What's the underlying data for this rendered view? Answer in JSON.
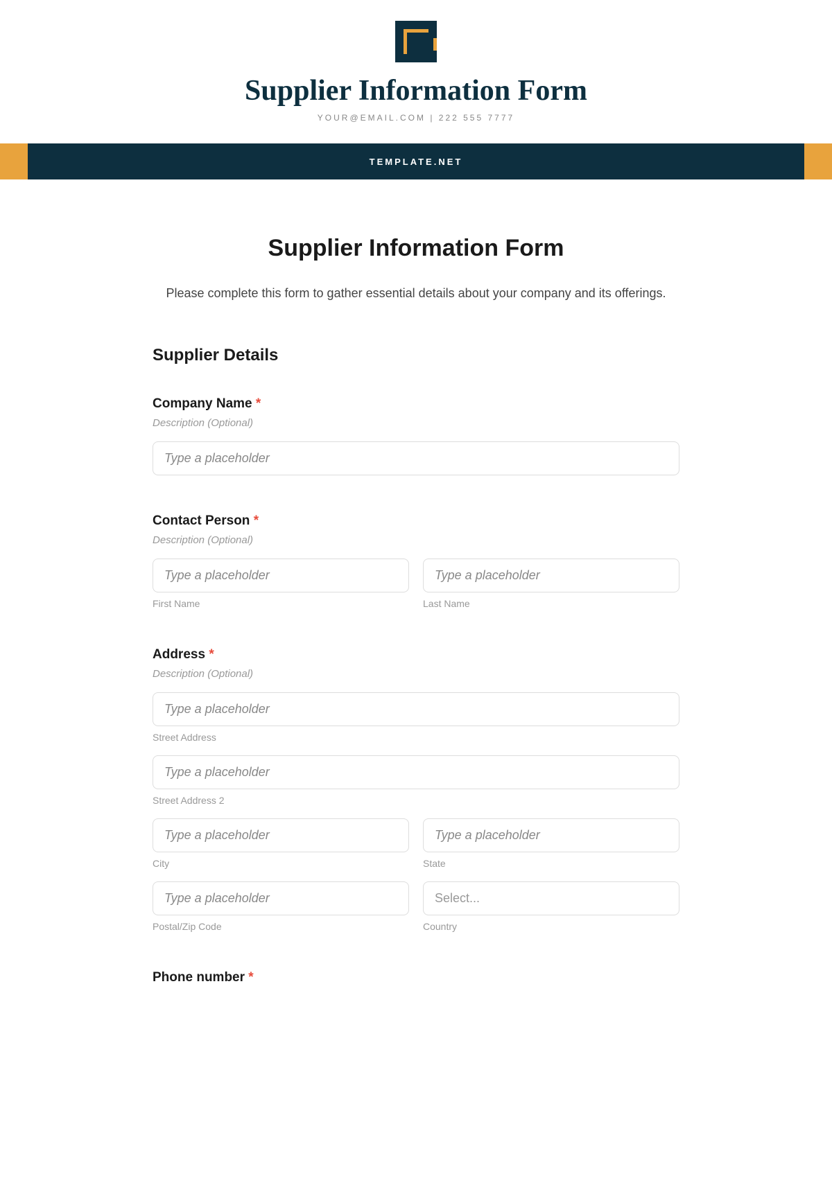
{
  "header": {
    "title": "Supplier Information Form",
    "contact": "YOUR@EMAIL.COM | 222 555 7777"
  },
  "banner": {
    "text": "TEMPLATE.NET"
  },
  "form": {
    "title": "Supplier Information Form",
    "description": "Please complete this form to gather essential details about your company and its offerings.",
    "section_title": "Supplier Details",
    "fields": {
      "company_name": {
        "label": "Company Name",
        "required": "*",
        "desc": "Description (Optional)",
        "placeholder": "Type a placeholder"
      },
      "contact_person": {
        "label": "Contact Person",
        "required": "*",
        "desc": "Description (Optional)",
        "first_placeholder": "Type a placeholder",
        "last_placeholder": "Type a placeholder",
        "first_sublabel": "First Name",
        "last_sublabel": "Last Name"
      },
      "address": {
        "label": "Address",
        "required": "*",
        "desc": "Description (Optional)",
        "street_placeholder": "Type a placeholder",
        "street_sublabel": "Street Address",
        "street2_placeholder": "Type a placeholder",
        "street2_sublabel": "Street Address 2",
        "city_placeholder": "Type a placeholder",
        "city_sublabel": "City",
        "state_placeholder": "Type a placeholder",
        "state_sublabel": "State",
        "postal_placeholder": "Type a placeholder",
        "postal_sublabel": "Postal/Zip Code",
        "country_placeholder": "Select...",
        "country_sublabel": "Country"
      },
      "phone": {
        "label": "Phone number",
        "required": "*"
      }
    }
  }
}
